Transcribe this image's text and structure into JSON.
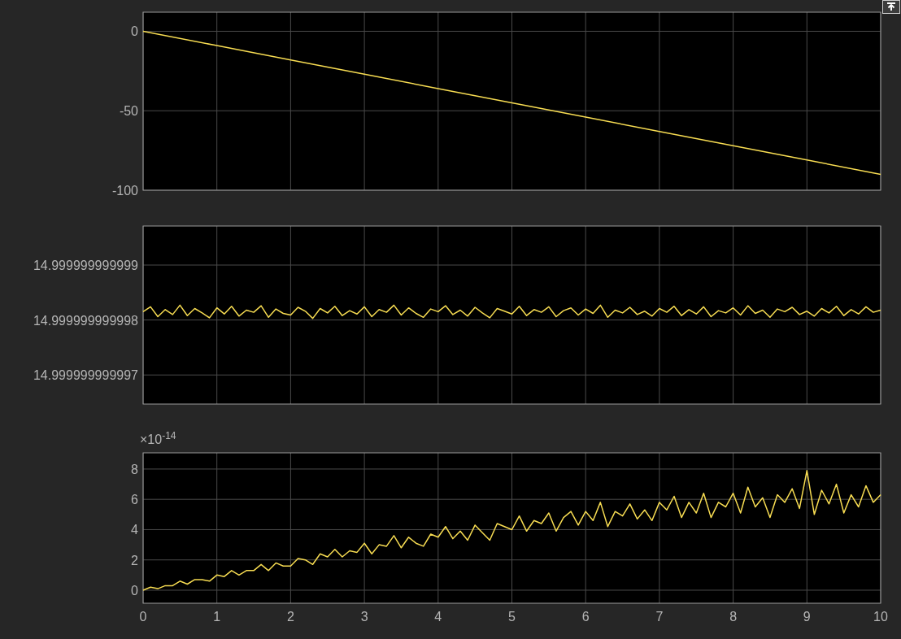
{
  "plots": [
    {
      "chart_data": {
        "type": "line",
        "x": [
          0,
          1,
          2,
          3,
          4,
          5,
          6,
          7,
          8,
          9,
          10
        ],
        "series": [
          {
            "color": "#f7dc52",
            "values": [
              0,
              -9,
              -18,
              -27,
              -36,
              -45,
              -54,
              -63,
              -72,
              -81,
              -90
            ]
          }
        ],
        "xlim": [
          0,
          10
        ],
        "ylim": [
          -100,
          12
        ],
        "yticks": [
          {
            "value": -100,
            "label": "-100"
          },
          {
            "value": -50,
            "label": "-50"
          },
          {
            "value": 0,
            "label": "0"
          }
        ],
        "grid": true
      }
    },
    {
      "chart_data": {
        "type": "line",
        "x": [
          0,
          0.1,
          0.2,
          0.3,
          0.4,
          0.5,
          0.6,
          0.7,
          0.8,
          0.9,
          1,
          1.1,
          1.2,
          1.3,
          1.4,
          1.5,
          1.6,
          1.7,
          1.8,
          1.9,
          2,
          2.1,
          2.2,
          2.3,
          2.4,
          2.5,
          2.6,
          2.7,
          2.8,
          2.9,
          3,
          3.1,
          3.2,
          3.3,
          3.4,
          3.5,
          3.6,
          3.7,
          3.8,
          3.9,
          4,
          4.1,
          4.2,
          4.3,
          4.4,
          4.5,
          4.6,
          4.7,
          4.8,
          4.9,
          5,
          5.1,
          5.2,
          5.3,
          5.4,
          5.5,
          5.6,
          5.7,
          5.8,
          5.9,
          6,
          6.1,
          6.2,
          6.3,
          6.4,
          6.5,
          6.6,
          6.7,
          6.8,
          6.9,
          7,
          7.1,
          7.2,
          7.3,
          7.4,
          7.5,
          7.6,
          7.7,
          7.8,
          7.9,
          8,
          8.1,
          8.2,
          8.3,
          8.4,
          8.5,
          8.6,
          8.7,
          8.8,
          8.9,
          9,
          9.1,
          9.2,
          9.3,
          9.4,
          9.5,
          9.6,
          9.7,
          9.8,
          9.9,
          10
        ],
        "series": [
          {
            "color": "#f7dc52",
            "values": [
              14.99999999999815,
              14.99999999999824,
              14.99999999999806,
              14.99999999999819,
              14.9999999999981,
              14.99999999999827,
              14.99999999999808,
              14.99999999999821,
              14.99999999999813,
              14.99999999999804,
              14.99999999999822,
              14.99999999999811,
              14.99999999999825,
              14.99999999999807,
              14.99999999999818,
              14.99999999999814,
              14.99999999999826,
              14.99999999999805,
              14.9999999999982,
              14.99999999999812,
              14.99999999999809,
              14.99999999999823,
              14.99999999999816,
              14.99999999999803,
              14.99999999999821,
              14.99999999999813,
              14.99999999999825,
              14.99999999999808,
              14.99999999999817,
              14.99999999999811,
              14.99999999999824,
              14.99999999999806,
              14.99999999999819,
              14.99999999999814,
              14.99999999999827,
              14.99999999999809,
              14.99999999999822,
              14.99999999999812,
              14.99999999999805,
              14.9999999999982,
              14.99999999999815,
              14.99999999999826,
              14.9999999999981,
              14.99999999999818,
              14.99999999999807,
              14.99999999999823,
              14.99999999999813,
              14.99999999999804,
              14.99999999999821,
              14.99999999999816,
              14.99999999999811,
              14.99999999999825,
              14.99999999999808,
              14.99999999999819,
              14.99999999999814,
              14.99999999999824,
              14.99999999999806,
              14.99999999999817,
              14.99999999999822,
              14.99999999999809,
              14.9999999999982,
              14.99999999999812,
              14.99999999999827,
              14.99999999999805,
              14.99999999999818,
              14.99999999999813,
              14.99999999999823,
              14.9999999999981,
              14.99999999999816,
              14.99999999999807,
              14.99999999999821,
              14.99999999999814,
              14.99999999999825,
              14.99999999999808,
              14.99999999999819,
              14.99999999999811,
              14.99999999999824,
              14.99999999999806,
              14.99999999999817,
              14.99999999999813,
              14.99999999999822,
              14.99999999999809,
              14.99999999999826,
              14.99999999999812,
              14.99999999999818,
              14.99999999999805,
              14.9999999999982,
              14.99999999999815,
              14.99999999999823,
              14.9999999999981,
              14.99999999999816,
              14.99999999999807,
              14.99999999999821,
              14.99999999999813,
              14.99999999999825,
              14.99999999999808,
              14.99999999999819,
              14.99999999999811,
              14.99999999999824,
              14.99999999999814,
              14.99999999999818
            ]
          }
        ],
        "xlim": [
          0,
          10
        ],
        "ylim": [
          14.99999999999647,
          14.99999999999971
        ],
        "yticks": [
          {
            "value": 14.999999999997,
            "label": "14.999999999997"
          },
          {
            "value": 14.999999999998,
            "label": "14.999999999998"
          },
          {
            "value": 14.999999999999,
            "label": "14.999999999999"
          }
        ],
        "grid": true
      }
    },
    {
      "chart_data": {
        "type": "line",
        "x": [
          0,
          0.1,
          0.2,
          0.3,
          0.4,
          0.5,
          0.6,
          0.7,
          0.8,
          0.9,
          1,
          1.1,
          1.2,
          1.3,
          1.4,
          1.5,
          1.6,
          1.7,
          1.8,
          1.9,
          2,
          2.1,
          2.2,
          2.3,
          2.4,
          2.5,
          2.6,
          2.7,
          2.8,
          2.9,
          3,
          3.1,
          3.2,
          3.3,
          3.4,
          3.5,
          3.6,
          3.7,
          3.8,
          3.9,
          4,
          4.1,
          4.2,
          4.3,
          4.4,
          4.5,
          4.6,
          4.7,
          4.8,
          4.9,
          5,
          5.1,
          5.2,
          5.3,
          5.4,
          5.5,
          5.6,
          5.7,
          5.8,
          5.9,
          6,
          6.1,
          6.2,
          6.3,
          6.4,
          6.5,
          6.6,
          6.7,
          6.8,
          6.9,
          7,
          7.1,
          7.2,
          7.3,
          7.4,
          7.5,
          7.6,
          7.7,
          7.8,
          7.9,
          8,
          8.1,
          8.2,
          8.3,
          8.4,
          8.5,
          8.6,
          8.7,
          8.8,
          8.9,
          9,
          9.1,
          9.2,
          9.3,
          9.4,
          9.5,
          9.6,
          9.7,
          9.8,
          9.9,
          10
        ],
        "series": [
          {
            "color": "#f7dc52",
            "values": [
              0,
              0.2,
              0.1,
              0.3,
              0.3,
              0.6,
              0.4,
              0.7,
              0.7,
              0.6,
              1.0,
              0.9,
              1.3,
              1.0,
              1.3,
              1.3,
              1.7,
              1.3,
              1.8,
              1.6,
              1.6,
              2.1,
              2.0,
              1.7,
              2.4,
              2.2,
              2.7,
              2.2,
              2.6,
              2.5,
              3.1,
              2.4,
              3.0,
              2.9,
              3.6,
              2.8,
              3.5,
              3.1,
              2.9,
              3.7,
              3.5,
              4.2,
              3.4,
              3.9,
              3.3,
              4.3,
              3.8,
              3.3,
              4.4,
              4.2,
              4.0,
              4.9,
              3.9,
              4.6,
              4.4,
              5.1,
              3.9,
              4.8,
              5.2,
              4.3,
              5.2,
              4.6,
              5.8,
              4.2,
              5.2,
              4.9,
              5.7,
              4.7,
              5.3,
              4.6,
              5.8,
              5.3,
              6.2,
              4.8,
              5.8,
              5.1,
              6.4,
              4.8,
              5.8,
              5.5,
              6.4,
              5.1,
              6.8,
              5.5,
              6.1,
              4.8,
              6.3,
              5.8,
              6.7,
              5.4,
              7.9,
              5.0,
              6.6,
              5.7,
              7.0,
              5.1,
              6.3,
              5.5,
              6.9,
              5.8,
              6.3
            ]
          }
        ],
        "xlim": [
          0,
          10
        ],
        "ylim": [
          -0.86,
          9.07
        ],
        "xticks": [
          0,
          1,
          2,
          3,
          4,
          5,
          6,
          7,
          8,
          9,
          10
        ],
        "yticks": [
          0,
          2,
          4,
          6,
          8
        ],
        "annotations": [
          "×10$^{-14}$"
        ],
        "grid": true
      }
    }
  ]
}
